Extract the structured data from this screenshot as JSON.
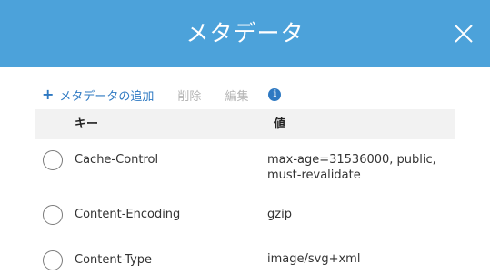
{
  "dialog": {
    "title": "メタデータ"
  },
  "toolbar": {
    "add_label": "メタデータの追加",
    "delete_label": "削除",
    "edit_label": "編集"
  },
  "table": {
    "columns": {
      "key": "キー",
      "value": "値"
    },
    "rows": [
      {
        "key": "Cache-Control",
        "value": "max-age=31536000, public, must-revalidate",
        "selected": false
      },
      {
        "key": "Content-Encoding",
        "value": "gzip",
        "selected": false
      },
      {
        "key": "Content-Type",
        "value": "image/svg+xml",
        "selected": false
      }
    ]
  },
  "colors": {
    "header_bg": "#4ca2da",
    "link": "#2e79c2",
    "disabled": "#b5b5b5"
  }
}
